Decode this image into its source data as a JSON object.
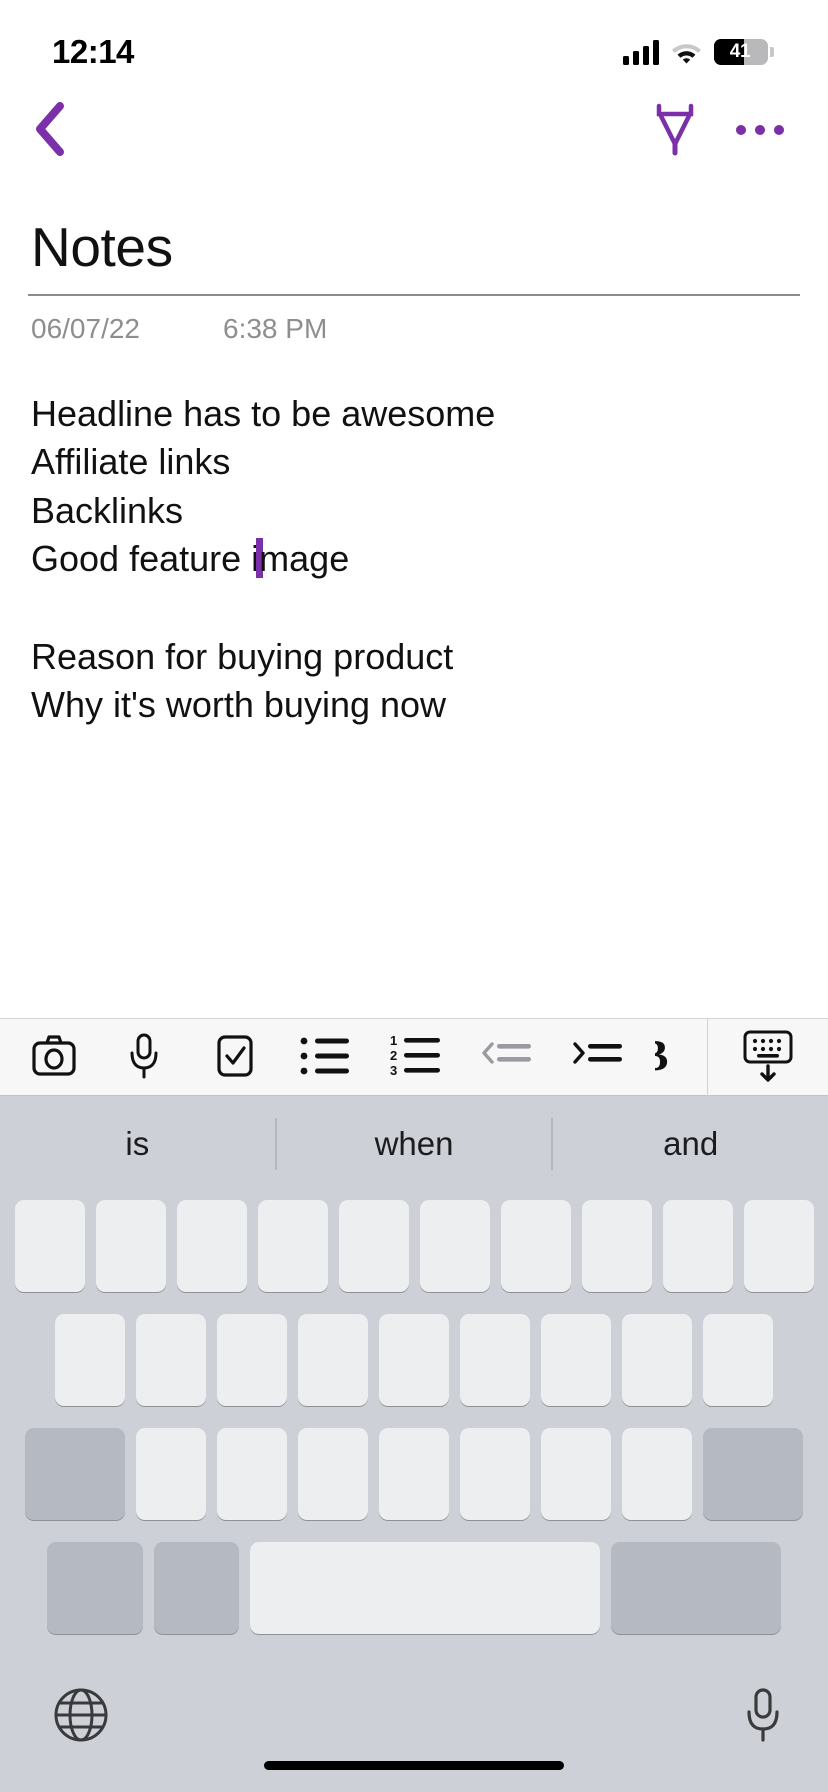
{
  "status_bar": {
    "time": "12:14",
    "battery_percent": "41",
    "signal_bars": 4,
    "icons": {
      "signal": "cellular-signal-icon",
      "wifi": "wifi-icon",
      "battery": "battery-icon"
    }
  },
  "nav_bar": {
    "back_label": "back-chevron",
    "highlighter_label": "highlighter-pen",
    "more_label": "more-options"
  },
  "note": {
    "title": "Notes",
    "date": "06/07/22",
    "time": "6:38 PM",
    "lines": [
      "Headline has to be awesome",
      "Affiliate links",
      "Backlinks",
      "Good feature i|mage",
      "",
      "Reason for buying product",
      "Why it's worth buying now"
    ],
    "caret_line_index": 3,
    "caret_before_text": "Good feature i",
    "caret_after_text": "mage",
    "accent_color": "#7b2fa8"
  },
  "format_toolbar": {
    "items": [
      {
        "name": "camera",
        "label": "Camera"
      },
      {
        "name": "microphone",
        "label": "Voice recording"
      },
      {
        "name": "checkbox",
        "label": "Checklist"
      },
      {
        "name": "bullet-list",
        "label": "Bulleted list"
      },
      {
        "name": "numbered-list",
        "label": "Numbered list"
      },
      {
        "name": "outdent",
        "label": "Decrease indent"
      },
      {
        "name": "indent",
        "label": "Increase indent"
      },
      {
        "name": "bold",
        "label": "Bold"
      }
    ],
    "hide_keyboard_label": "Hide keyboard"
  },
  "keyboard": {
    "suggestions": [
      "is",
      "when",
      "and"
    ],
    "row1_keys": 10,
    "row2_keys": 9,
    "row3_keys": 9,
    "globe_label": "Change keyboard language",
    "mic_label": "Voice input"
  }
}
